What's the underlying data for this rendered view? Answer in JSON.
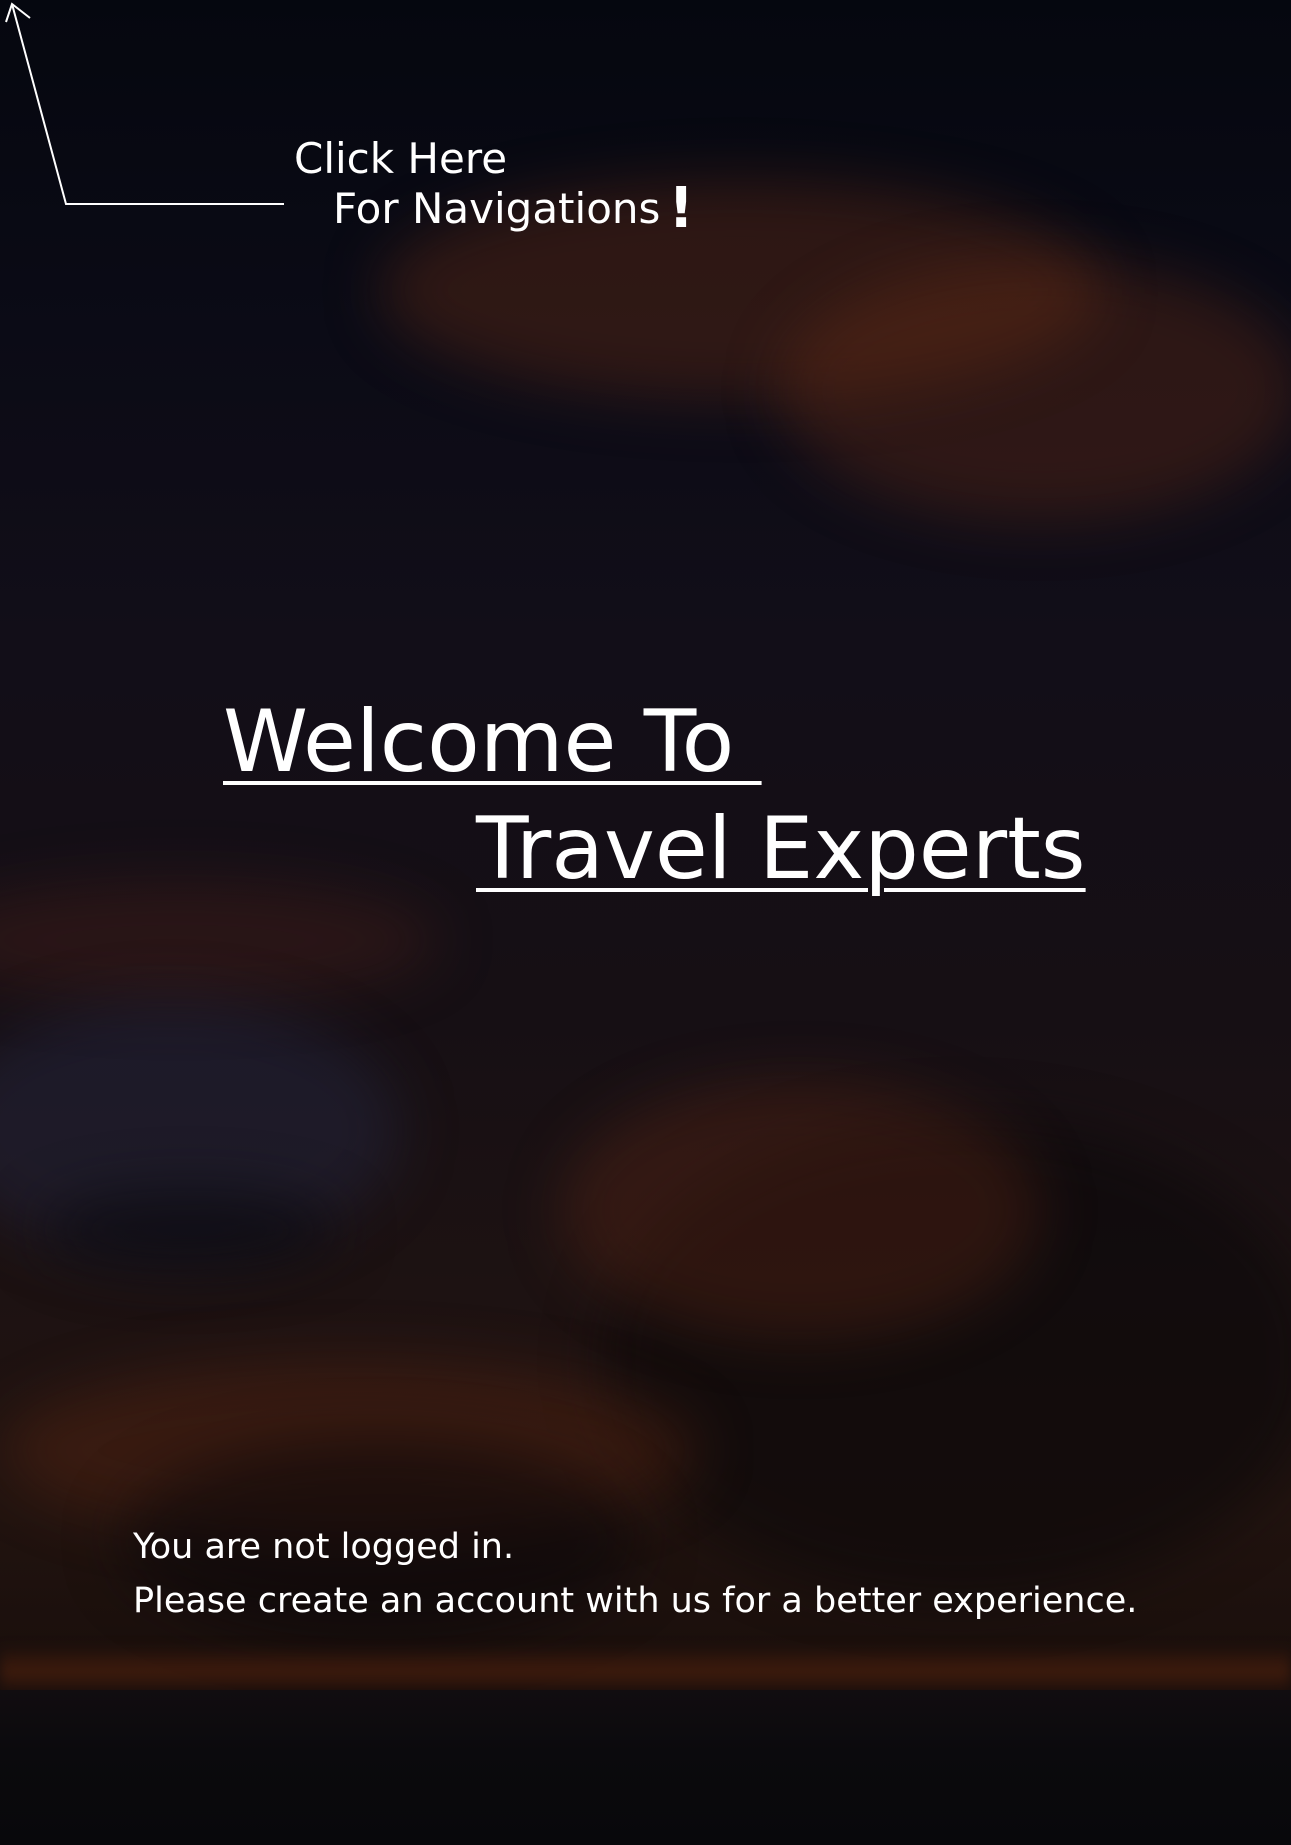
{
  "navigation_hint": {
    "line1": "Click Here",
    "line2": "For Navigations",
    "exclamation": "!",
    "arrow_icon": "arrow-up-left-icon"
  },
  "hero": {
    "welcome_line": "Welcome To ",
    "brand_line": "Travel Experts"
  },
  "status": {
    "line1": "You are not logged in.",
    "line2": "Please create an account with us for a better experience."
  },
  "colors": {
    "text": "#ffffff",
    "sky_top": "#05070f",
    "sky_glow": "#5a2410"
  }
}
